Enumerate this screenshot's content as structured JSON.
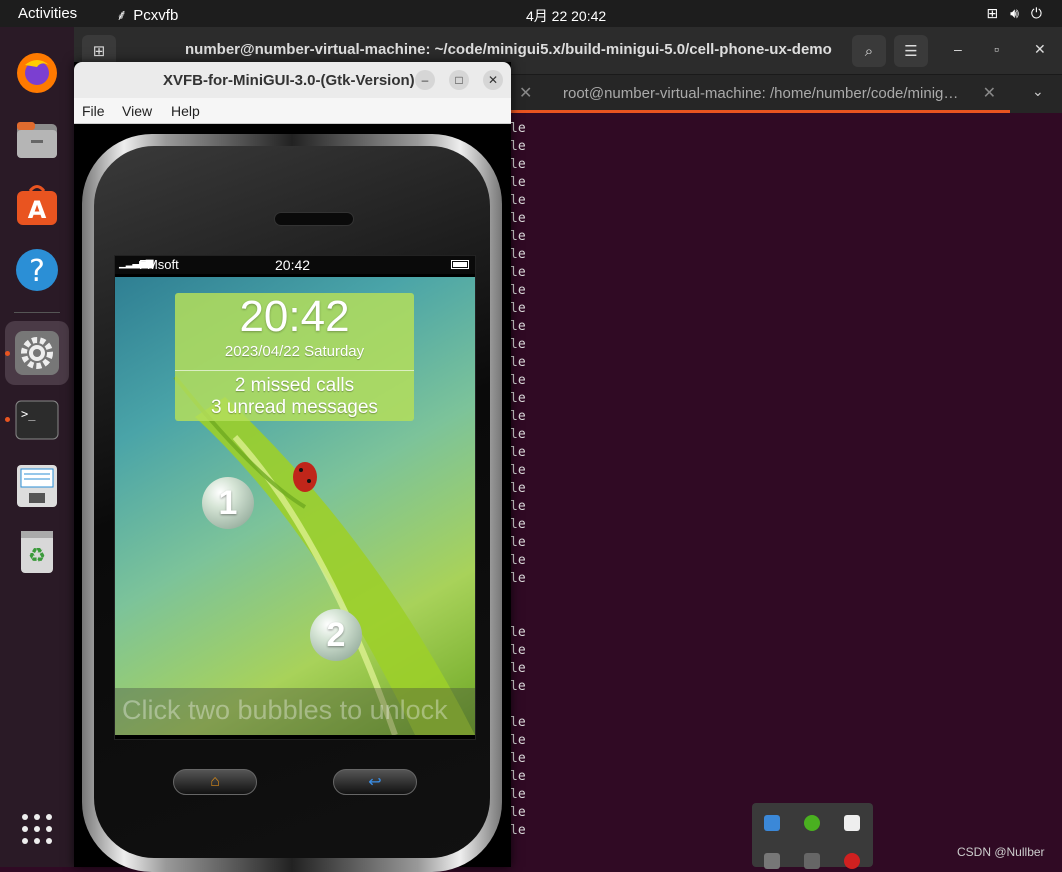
{
  "topbar": {
    "activities": "Activities",
    "app_name": "Pcxvfb",
    "clock": "4月 22  20:42"
  },
  "terminal": {
    "title": "number@number-virtual-machine: ~/code/minigui5.x/build-minigui-5.0/cell-phone-ux-demo",
    "tab2_title": "root@number-virtual-machine: /home/number/code/minig…",
    "output_fragment": "le"
  },
  "xvfb": {
    "title": "XVFB-for-MiniGUI-3.0-(Gtk-Version)",
    "menu": [
      "File",
      "View",
      "Help"
    ]
  },
  "phone": {
    "carrier": "FMsoft",
    "status_time": "20:42",
    "lock_time": "20:42",
    "lock_date": "2023/04/22 Saturday",
    "missed_calls": "2 missed calls",
    "unread_messages": "3 unread messages",
    "bubble1": "1",
    "bubble2": "2",
    "unlock_hint": "Click two bubbles to unlock"
  },
  "watermark": "CSDN @Nullber",
  "colors": {
    "accent": "#e95420",
    "terminal_bg": "#300a24"
  }
}
